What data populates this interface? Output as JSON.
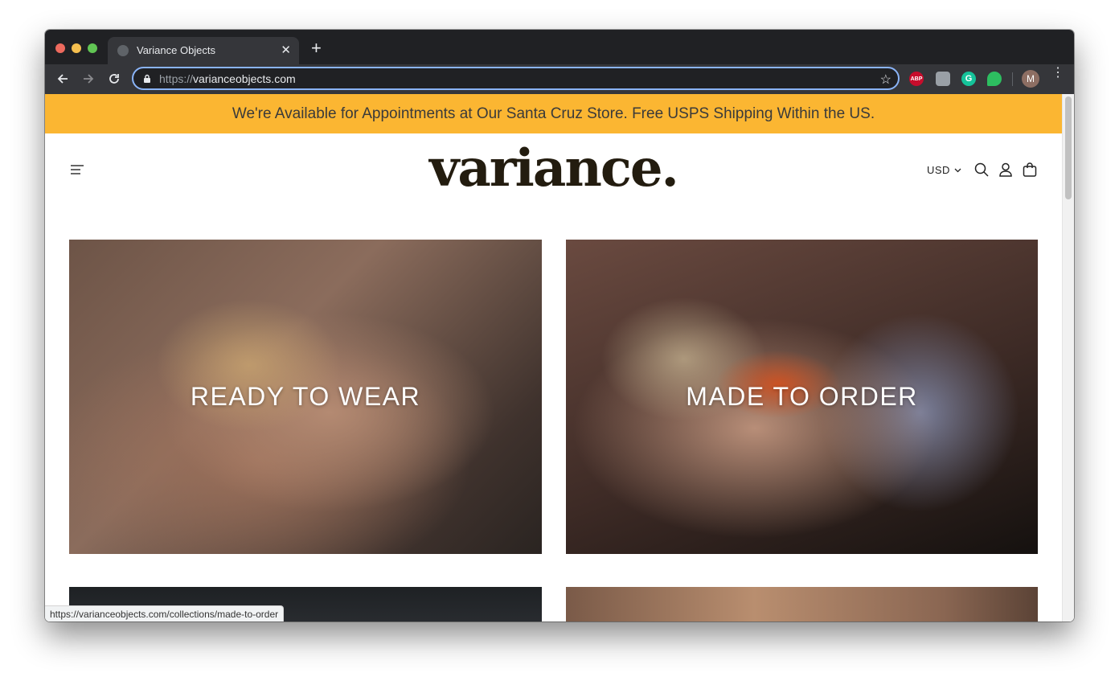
{
  "browser": {
    "tab_title": "Variance Objects",
    "url_scheme": "https://",
    "url_host": "varianceobjects.com",
    "profile_initial": "M",
    "extensions": {
      "abp_label": "ABP",
      "grammarly_label": "G"
    },
    "status_url": "https://varianceobjects.com/collections/made-to-order"
  },
  "site": {
    "announcement": "We're Available for Appointments at Our Santa Cruz Store. Free USPS Shipping Within the US.",
    "logo": "variance.",
    "currency": "USD",
    "accent_color": "#fbb632",
    "tiles": [
      {
        "label": "READY TO WEAR"
      },
      {
        "label": "MADE TO ORDER"
      }
    ]
  }
}
